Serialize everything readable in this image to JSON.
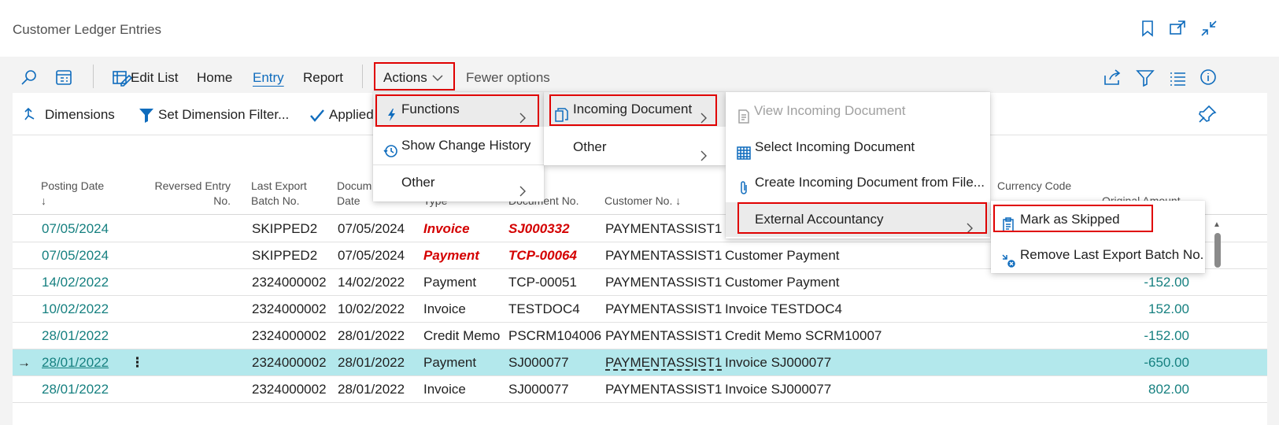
{
  "page": {
    "title": "Customer Ledger Entries"
  },
  "toolbar": {
    "edit_list": "Edit List",
    "home": "Home",
    "entry": "Entry",
    "report": "Report",
    "actions": "Actions",
    "fewer_options": "Fewer options"
  },
  "actionbar": {
    "dimensions": "Dimensions",
    "set_dimension_filter": "Set Dimension Filter...",
    "applied": "Applied"
  },
  "columns": {
    "posting_date": "Posting Date",
    "reversed_entry_no_1": "Reversed Entry",
    "reversed_entry_no_2": "No.",
    "last_export_1": "Last Export",
    "last_export_2": "Batch No.",
    "document_date_1": "Docum",
    "document_date_2": "Date",
    "type": "Type",
    "document_no": "Document No.",
    "customer_no": "Customer No. ↓",
    "currency_code": "Currency Code",
    "original_amount": "Original Amount"
  },
  "rows": [
    {
      "posting_date": "07/05/2024",
      "batch": "SKIPPED2",
      "doc_date": "07/05/2024",
      "type": "Invoice",
      "doc_no": "SJ000332",
      "customer": "PAYMENTASSIST1",
      "description": "",
      "amount": ""
    },
    {
      "posting_date": "07/05/2024",
      "batch": "SKIPPED2",
      "doc_date": "07/05/2024",
      "type": "Payment",
      "doc_no": "TCP-00064",
      "customer": "PAYMENTASSIST1",
      "description": "Customer Payment",
      "amount": ""
    },
    {
      "posting_date": "14/02/2022",
      "batch": "2324000002",
      "doc_date": "14/02/2022",
      "type": "Payment",
      "doc_no": "TCP-00051",
      "customer": "PAYMENTASSIST1",
      "description": "Customer Payment",
      "amount": "-152.00"
    },
    {
      "posting_date": "10/02/2022",
      "batch": "2324000002",
      "doc_date": "10/02/2022",
      "type": "Invoice",
      "doc_no": "TESTDOC4",
      "customer": "PAYMENTASSIST1",
      "description": "Invoice TESTDOC4",
      "amount": "152.00"
    },
    {
      "posting_date": "28/01/2022",
      "batch": "2324000002",
      "doc_date": "28/01/2022",
      "type": "Credit Memo",
      "doc_no": "PSCRM104006",
      "customer": "PAYMENTASSIST1",
      "description": "Credit Memo SCRM10007",
      "amount": "-152.00"
    },
    {
      "posting_date": "28/01/2022",
      "batch": "2324000002",
      "doc_date": "28/01/2022",
      "type": "Payment",
      "doc_no": "SJ000077",
      "customer": "PAYMENTASSIST1",
      "description": "Invoice SJ000077",
      "amount": "-650.00"
    },
    {
      "posting_date": "28/01/2022",
      "batch": "2324000002",
      "doc_date": "28/01/2022",
      "type": "Invoice",
      "doc_no": "SJ000077",
      "customer": "PAYMENTASSIST1",
      "description": "Invoice SJ000077",
      "amount": "802.00"
    }
  ],
  "menus": {
    "actions_menu": {
      "functions": "Functions",
      "show_change_history": "Show Change History",
      "other": "Other"
    },
    "functions_menu": {
      "incoming_document": "Incoming Document",
      "other": "Other"
    },
    "incoming_document_menu": {
      "view": "View Incoming Document",
      "select": "Select Incoming Document",
      "create_from_file": "Create Incoming Document from File...",
      "external_accountancy": "External Accountancy"
    },
    "external_accountancy_menu": {
      "mark_as_skipped": "Mark as Skipped",
      "remove_last_export": "Remove Last Export Batch No."
    }
  },
  "colors": {
    "accent": "#0f6cbd",
    "link": "#168080",
    "highlight": "#d40000",
    "selected_row": "#b3e8ec"
  }
}
